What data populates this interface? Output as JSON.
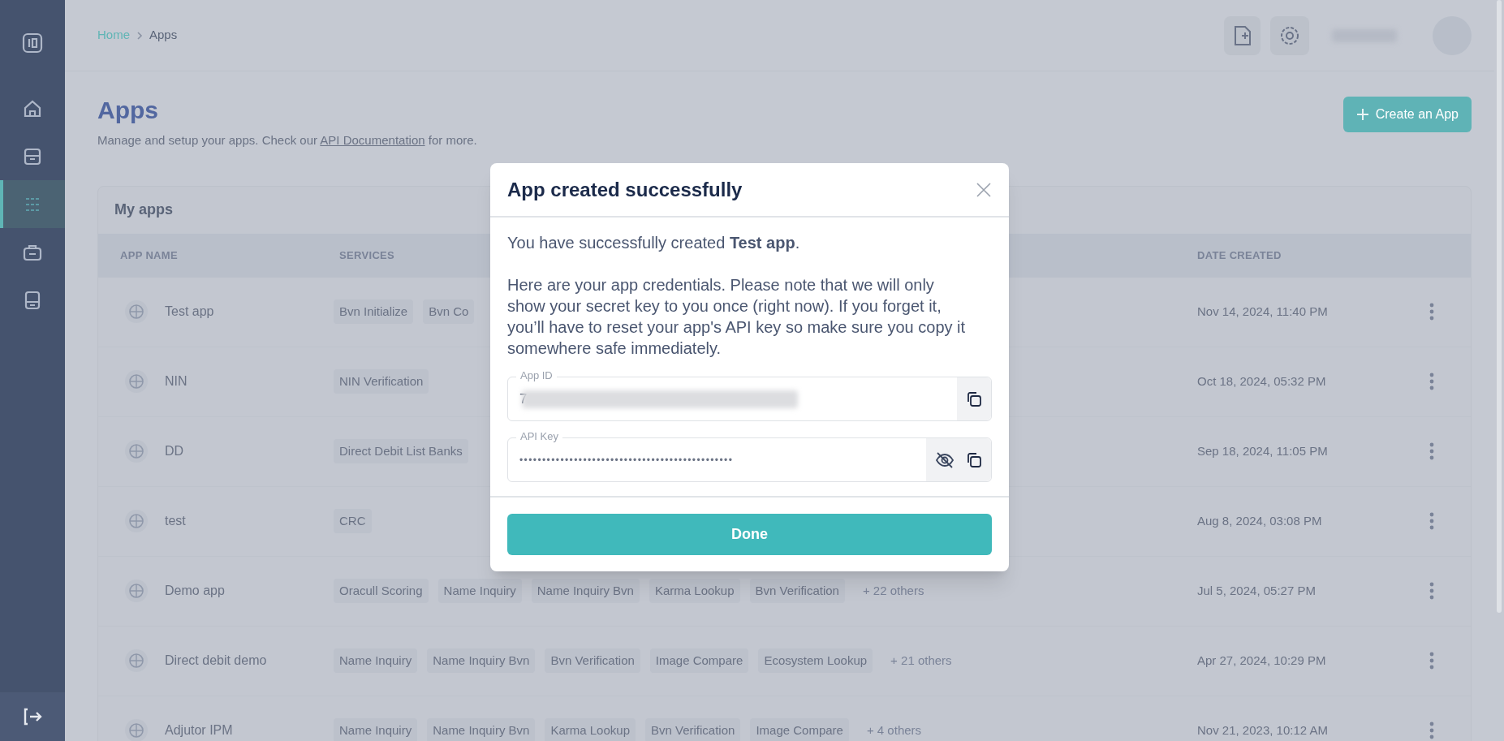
{
  "sidebar": {
    "items": [
      {
        "selected": false
      },
      {
        "selected": false
      },
      {
        "selected": true
      },
      {
        "selected": false
      },
      {
        "selected": false
      }
    ]
  },
  "breadcrumb": [
    {
      "label": "Home",
      "current": false
    },
    {
      "label": "Apps",
      "current": true
    }
  ],
  "page": {
    "title": "Apps",
    "subtitle_before": "Manage and setup your apps. Check our ",
    "subtitle_link": "API Documentation",
    "subtitle_after": " for more."
  },
  "create_button": {
    "label": "Create an App"
  },
  "table": {
    "title": "My apps",
    "columns": [
      "APP NAME",
      "SERVICES",
      "DATE CREATED"
    ],
    "rows": [
      {
        "name": "Test app",
        "services": [
          "Bvn Initialize",
          "Bvn Co"
        ],
        "more": "",
        "date": "Nov 14, 2024, 11:40 PM"
      },
      {
        "name": "NIN",
        "services": [
          "NIN Verification"
        ],
        "more": "",
        "date": "Oct 18, 2024, 05:32 PM"
      },
      {
        "name": "DD",
        "services": [
          "Direct Debit List Banks"
        ],
        "more": "",
        "date": "Sep 18, 2024, 11:05 PM"
      },
      {
        "name": "test",
        "services": [
          "CRC"
        ],
        "more": "",
        "date": "Aug 8, 2024, 03:08 PM"
      },
      {
        "name": "Demo app",
        "services": [
          "Oracull Scoring",
          "Name Inquiry",
          "Name Inquiry Bvn",
          "Karma Lookup",
          "Bvn Verification"
        ],
        "more": "+ 22 others",
        "date": "Jul 5, 2024, 05:27 PM"
      },
      {
        "name": "Direct debit demo",
        "services": [
          "Name Inquiry",
          "Name Inquiry Bvn",
          "Bvn Verification",
          "Image Compare",
          "Ecosystem Lookup"
        ],
        "more": "+ 21 others",
        "date": "Apr 27, 2024, 10:29 PM"
      },
      {
        "name": "Adjutor IPM",
        "services": [
          "Name Inquiry",
          "Name Inquiry Bvn",
          "Karma Lookup",
          "Bvn Verification",
          "Image Compare"
        ],
        "more": "+ 4 others",
        "date": "Nov 21, 2023, 10:12 AM"
      }
    ]
  },
  "modal": {
    "title": "App created successfully",
    "intro": "You have successfully created **Test app**.",
    "note": "Here are your app credentials. Please note that we will only show your secret key to you once (right now). If you forget it, you’ll have to reset your app's API key so make sure you copy it somewhere safe immediately.",
    "fields": [
      {
        "kind": "id",
        "label": "App ID",
        "value": "7",
        "redacted": true
      },
      {
        "kind": "secret",
        "label": "API Key",
        "value": "•••••••••••••••••••••••••••••••••••••••••••••••",
        "revealed": false
      }
    ],
    "button": "Done"
  }
}
